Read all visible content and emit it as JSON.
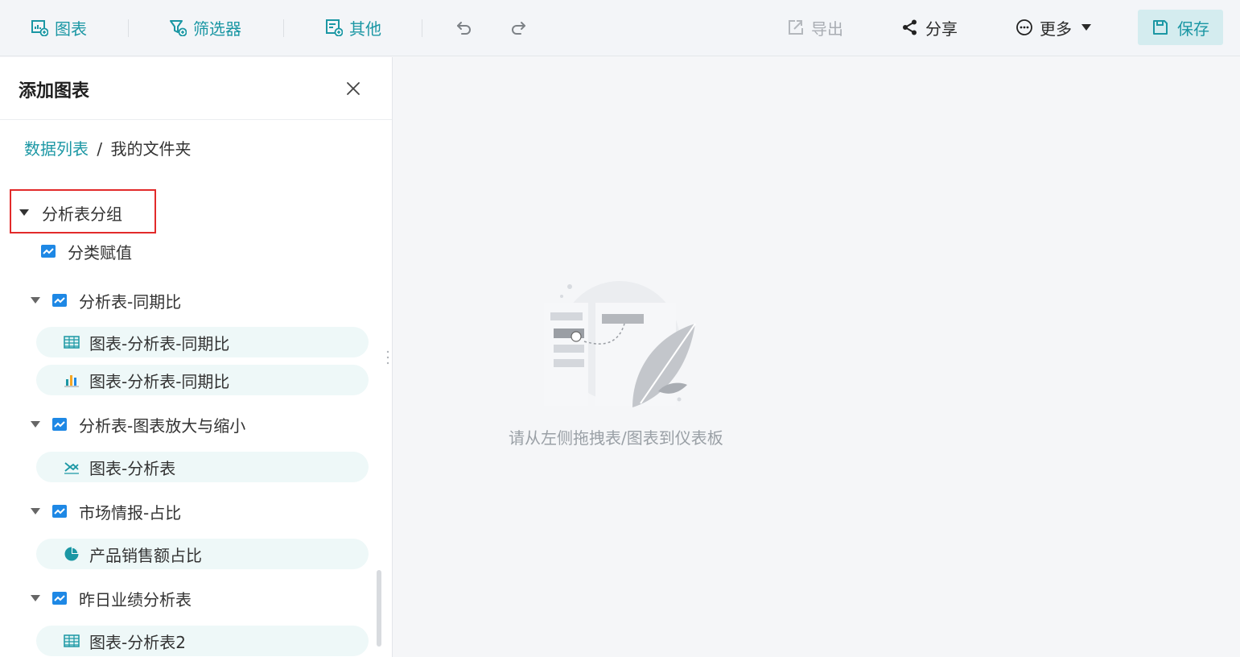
{
  "toolbar": {
    "chart_label": "图表",
    "filter_label": "筛选器",
    "other_label": "其他",
    "export_label": "导出",
    "share_label": "分享",
    "more_label": "更多",
    "save_label": "保存"
  },
  "panel": {
    "title": "添加图表",
    "breadcrumb": {
      "link": "数据列表",
      "separator": "/",
      "current": "我的文件夹"
    }
  },
  "tree": {
    "group_label": "分析表分组",
    "group_child": "分类赋值",
    "nodes": [
      {
        "label": "分析表-同期比",
        "children": [
          {
            "label": "图表-分析表-同期比",
            "icon": "table-icon"
          },
          {
            "label": "图表-分析表-同期比",
            "icon": "bar-chart-icon"
          }
        ]
      },
      {
        "label": "分析表-图表放大与缩小",
        "children": [
          {
            "label": "图表-分析表",
            "icon": "cross-line-icon"
          }
        ]
      },
      {
        "label": "市场情报-占比",
        "children": [
          {
            "label": "产品销售额占比",
            "icon": "pie-chart-icon"
          }
        ]
      },
      {
        "label": "昨日业绩分析表",
        "children": [
          {
            "label": "图表-分析表2",
            "icon": "table-icon"
          }
        ]
      }
    ]
  },
  "canvas": {
    "empty_text": "请从左侧拖拽表/图表到仪表板"
  },
  "colors": {
    "accent": "#1b97a4",
    "highlight": "#e22a2a",
    "save_bg": "#d4ecef",
    "leaf_bg": "#eef8f8"
  }
}
